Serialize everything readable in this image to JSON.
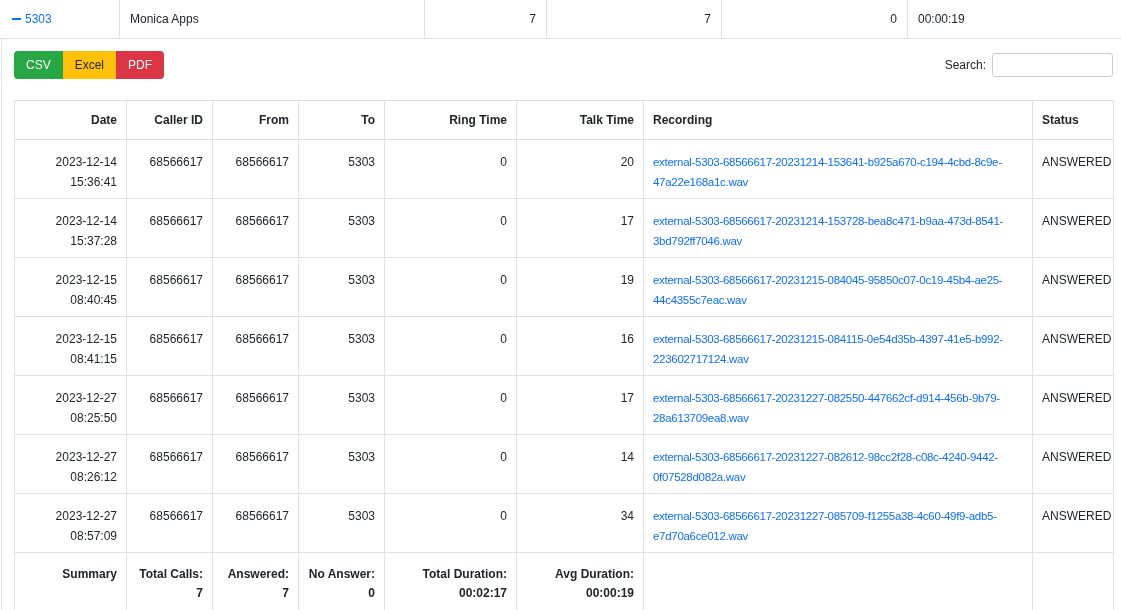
{
  "group_row": {
    "extension": "5303",
    "expanded": true,
    "cells": [
      "Monica Apps",
      "7",
      "7",
      "0",
      "00:00:19"
    ]
  },
  "export_buttons": [
    {
      "label": "CSV",
      "color": "#28a745"
    },
    {
      "label": "Excel",
      "color": "#ffc107"
    },
    {
      "label": "PDF",
      "color": "#dc3545"
    }
  ],
  "search": {
    "label": "Search:"
  },
  "table": {
    "columns": [
      "Date",
      "Caller ID",
      "From",
      "To",
      "Ring Time",
      "Talk Time",
      "Recording",
      "Status"
    ],
    "rows": [
      {
        "date": "2023-12-14 15:36:41",
        "caller_id": "68566617",
        "from": "68566617",
        "to": "5303",
        "ring_time": "0",
        "talk_time": "20",
        "recording": "external-5303-68566617-20231214-153641-b925a670-c194-4cbd-8c9e-47a22e168a1c.wav",
        "status": "ANSWERED"
      },
      {
        "date": "2023-12-14 15:37:28",
        "caller_id": "68566617",
        "from": "68566617",
        "to": "5303",
        "ring_time": "0",
        "talk_time": "17",
        "recording": "external-5303-68566617-20231214-153728-bea8c471-b9aa-473d-8541-3bd792ff7046.wav",
        "status": "ANSWERED"
      },
      {
        "date": "2023-12-15 08:40:45",
        "caller_id": "68566617",
        "from": "68566617",
        "to": "5303",
        "ring_time": "0",
        "talk_time": "19",
        "recording": "external-5303-68566617-20231215-084045-95850c07-0c19-45b4-ae25-44c4355c7eac.wav",
        "status": "ANSWERED"
      },
      {
        "date": "2023-12-15 08:41:15",
        "caller_id": "68566617",
        "from": "68566617",
        "to": "5303",
        "ring_time": "0",
        "talk_time": "16",
        "recording": "external-5303-68566617-20231215-084115-0e54d35b-4397-41e5-b992-223602717124.wav",
        "status": "ANSWERED"
      },
      {
        "date": "2023-12-27 08:25:50",
        "caller_id": "68566617",
        "from": "68566617",
        "to": "5303",
        "ring_time": "0",
        "talk_time": "17",
        "recording": "external-5303-68566617-20231227-082550-447662cf-d914-456b-9b79-28a613709ea8.wav",
        "status": "ANSWERED"
      },
      {
        "date": "2023-12-27 08:26:12",
        "caller_id": "68566617",
        "from": "68566617",
        "to": "5303",
        "ring_time": "0",
        "talk_time": "14",
        "recording": "external-5303-68566617-20231227-082612-98cc2f28-c08c-4240-9442-0f07528d082a.wav",
        "status": "ANSWERED"
      },
      {
        "date": "2023-12-27 08:57:09",
        "caller_id": "68566617",
        "from": "68566617",
        "to": "5303",
        "ring_time": "0",
        "talk_time": "34",
        "recording": "external-5303-68566617-20231227-085709-f1255a38-4c60-49f9-adb5-e7d70a6ce012.wav",
        "status": "ANSWERED"
      }
    ],
    "summary": {
      "title": "Summary",
      "items": [
        {
          "label": "Total Calls:",
          "value": "7"
        },
        {
          "label": "Answered:",
          "value": "7"
        },
        {
          "label": "No Answer:",
          "value": "0"
        },
        {
          "label": "Total Duration:",
          "value": "00:02:17"
        },
        {
          "label": "Avg Duration:",
          "value": "00:00:19"
        }
      ]
    }
  }
}
